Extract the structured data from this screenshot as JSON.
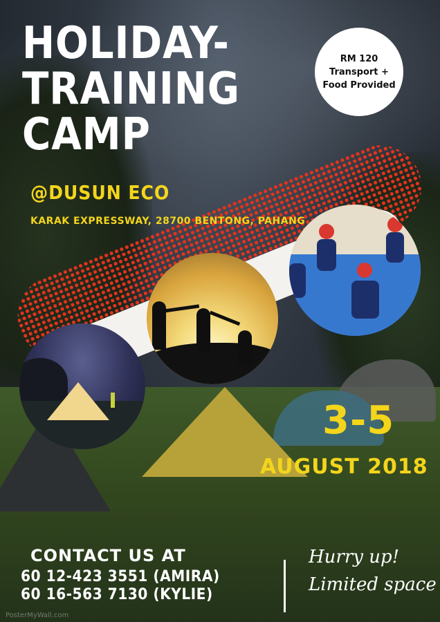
{
  "title": "HOLIDAY-\nTRAINING\nCAMP",
  "venue": "@DUSUN ECO",
  "address": "KARAK EXPRESSWAY, 28700 BENTONG, PAHANG",
  "badge": {
    "price": "RM 120",
    "line2": "Transport +",
    "line3": "Food Provided"
  },
  "dates": "3-5",
  "month": "AUGUST 2018",
  "contact": {
    "heading": "CONTACT US AT",
    "phone1": "60 12-423 3551 (AMIRA)",
    "phone2": "60 16-563 7130 (KYLIE)"
  },
  "tagline": "Hurry up!\nLimited space",
  "watermark": "PosterMyWall.com",
  "colors": {
    "accent_yellow": "#f3d51c",
    "dot_red": "#e2331e",
    "text_white": "#ffffff"
  }
}
